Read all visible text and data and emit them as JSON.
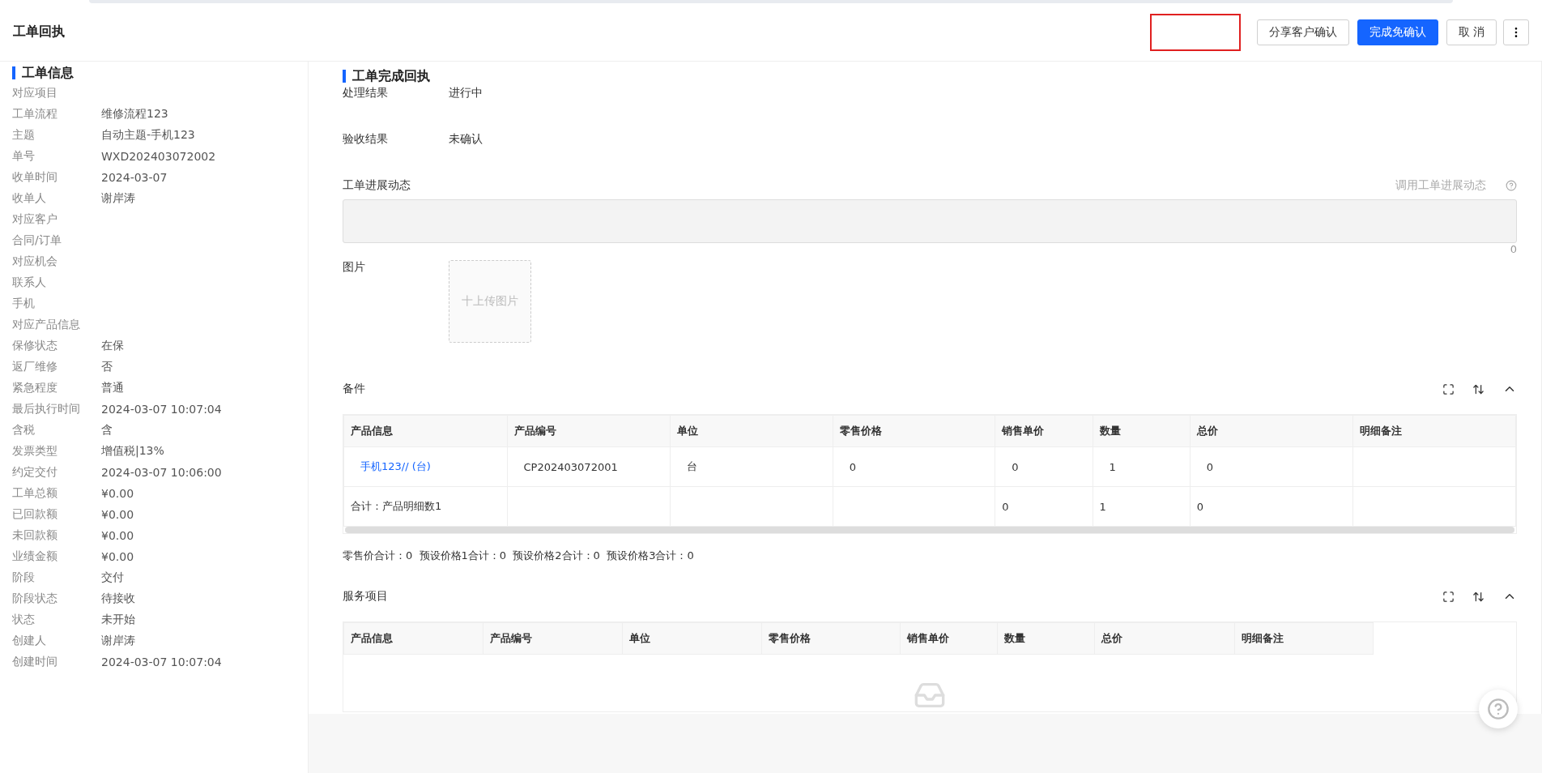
{
  "header": {
    "title": "工单回执",
    "buttons": [
      {
        "label": "分享客户确认",
        "kind": "default"
      },
      {
        "label": "完成免确认",
        "kind": "primary"
      },
      {
        "label": "取 消",
        "kind": "default"
      }
    ]
  },
  "info": {
    "title": "工单信息",
    "fields": [
      {
        "label": "对应项目"
      },
      {
        "label": "工单流程",
        "value": "维修流程123"
      },
      {
        "label": "主题",
        "value": "自动主题-手机123"
      },
      {
        "label": "单号",
        "value": "WXD202403072002"
      },
      {
        "label": "收单时间",
        "value": "2024-03-07"
      },
      {
        "label": "收单人",
        "value": "谢岸涛"
      },
      {
        "label": "对应客户"
      },
      {
        "label": "合同/订单"
      },
      {
        "label": "对应机会"
      },
      {
        "label": "联系人"
      },
      {
        "label": "手机"
      },
      {
        "label": "对应产品信息"
      },
      {
        "label": "保修状态",
        "value": "在保"
      },
      {
        "label": "返厂维修",
        "value": "否"
      },
      {
        "label": "紧急程度",
        "value": "普通"
      },
      {
        "label": "最后执行时间",
        "value": "2024-03-07 10:07:04"
      },
      {
        "label": "含税",
        "value": "含"
      },
      {
        "label": "发票类型",
        "value": "增值税|13%"
      },
      {
        "label": "约定交付",
        "value": "2024-03-07 10:06:00"
      },
      {
        "label": "工单总额",
        "value": "¥0.00"
      },
      {
        "label": "已回款额",
        "value": "¥0.00"
      },
      {
        "label": "未回款额",
        "value": "¥0.00"
      },
      {
        "label": "业绩金额",
        "value": "¥0.00"
      },
      {
        "label": "阶段",
        "value": "交付"
      },
      {
        "label": "阶段状态",
        "value": "待接收"
      },
      {
        "label": "状态",
        "value": "未开始"
      },
      {
        "label": "创建人",
        "value": "谢岸涛"
      },
      {
        "label": "创建时间",
        "value": "2024-03-07 10:07:04"
      }
    ]
  },
  "receipt": {
    "title": "工单完成回执",
    "fields": [
      {
        "label": "处理结果",
        "value": "进行中"
      },
      {
        "label": "验收结果",
        "value": "未确认"
      }
    ],
    "progress": {
      "label": "工单进展动态",
      "action": "调用工单进展动态",
      "count": "0"
    },
    "image": {
      "label": "图片",
      "upload": "十上传图片"
    }
  },
  "parts": {
    "title": "备件",
    "columns": [
      "产品信息",
      "产品编号",
      "单位",
      "零售价格",
      "销售单价",
      "数量",
      "总价",
      "明细备注"
    ],
    "rows": [
      {
        "kind": "item",
        "cells": [
          "手机123// (台)",
          "CP202403072001",
          "台",
          "0",
          "0",
          "1",
          "0",
          ""
        ]
      },
      {
        "kind": "total",
        "cells": [
          "合计：产品明细数1",
          "",
          "",
          "",
          "0",
          "1",
          "0",
          ""
        ]
      }
    ],
    "summary": "零售价合计：0  预设价格1合计：0  预设价格2合计：0  预设价格3合计：0"
  },
  "services": {
    "title": "服务项目",
    "columns": [
      "产品信息",
      "产品编号",
      "单位",
      "零售价格",
      "销售单价",
      "数量",
      "总价",
      "明细备注"
    ]
  }
}
